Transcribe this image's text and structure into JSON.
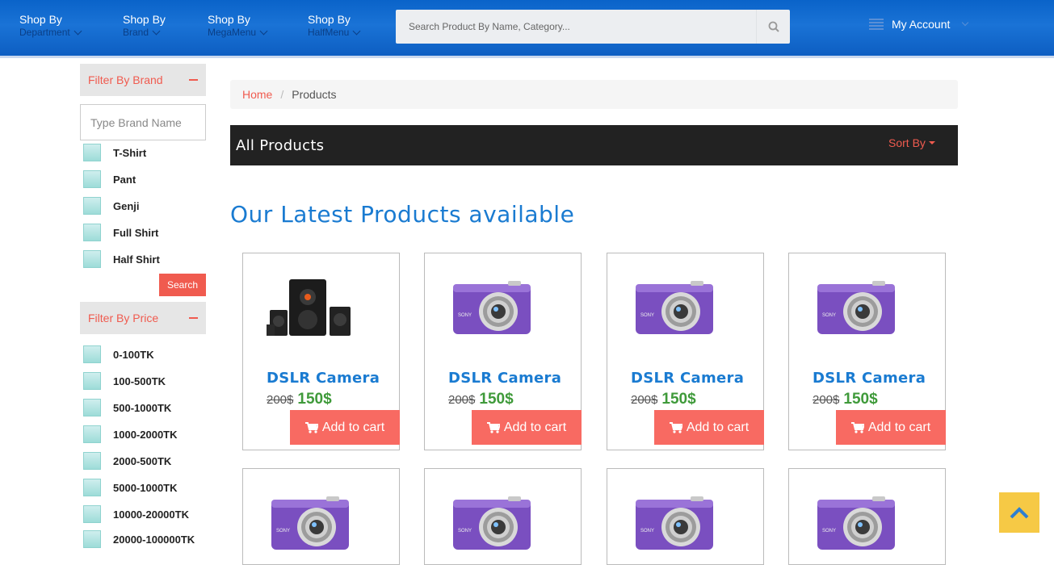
{
  "nav": {
    "items": [
      {
        "line1": "Shop By",
        "line2": "Department"
      },
      {
        "line1": "Shop By",
        "line2": "Brand"
      },
      {
        "line1": "Shop By",
        "line2": "MegaMenu"
      },
      {
        "line1": "Shop By",
        "line2": "HalfMenu"
      }
    ],
    "search_placeholder": "Search Product By Name, Category...",
    "account_label": "My Account"
  },
  "sidebar": {
    "brand_filter": {
      "title": "Filter By Brand",
      "input_placeholder": "Type Brand Name",
      "options": [
        "T-Shirt",
        "Pant",
        "Genji",
        "Full Shirt",
        "Half Shirt"
      ],
      "search_label": "Search"
    },
    "price_filter": {
      "title": "Filter By Price",
      "options": [
        "0-100TK",
        "100-500TK",
        "500-1000TK",
        "1000-2000TK",
        "2000-500TK",
        "5000-1000TK",
        "10000-20000TK",
        "20000-100000TK"
      ]
    }
  },
  "breadcrumb": {
    "home": "Home",
    "separator": "/",
    "current": "Products"
  },
  "products_bar": {
    "title": "All Products",
    "sort_label": "Sort By"
  },
  "section_title": "Our Latest Products available",
  "products": [
    {
      "name": "DSLR Camera",
      "old_price": "200$",
      "new_price": "150$",
      "cart_label": "Add to cart",
      "image": "speaker-system"
    },
    {
      "name": "DSLR Camera",
      "old_price": "200$",
      "new_price": "150$",
      "cart_label": "Add to cart",
      "image": "purple-camera"
    },
    {
      "name": "DSLR Camera",
      "old_price": "200$",
      "new_price": "150$",
      "cart_label": "Add to cart",
      "image": "purple-camera"
    },
    {
      "name": "DSLR Camera",
      "old_price": "200$",
      "new_price": "150$",
      "cart_label": "Add to cart",
      "image": "purple-camera"
    }
  ],
  "colors": {
    "brand_blue": "#0a63c9",
    "accent_red": "#f05b4f",
    "price_green": "#3f9a3a",
    "title_blue": "#1a7bd1",
    "scroll_top": "#f6c945"
  }
}
